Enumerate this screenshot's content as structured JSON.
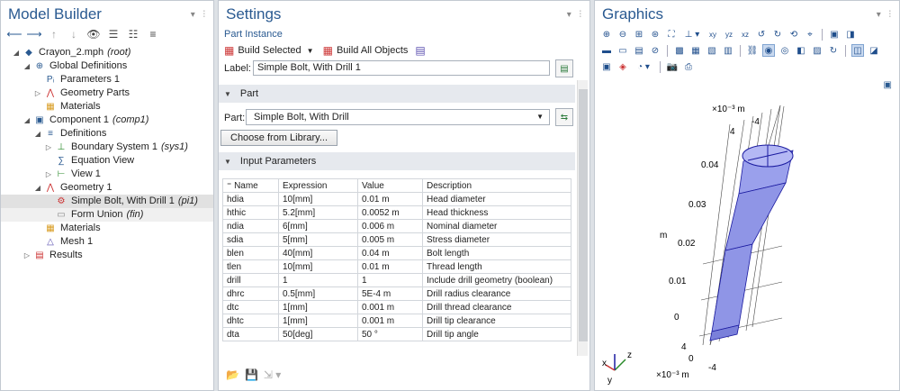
{
  "model_builder": {
    "title": "Model Builder",
    "tree": [
      {
        "label": "Crayon_2.mph",
        "suffix": "(root)",
        "level": 0,
        "tw": "◢",
        "icon": "model-icon"
      },
      {
        "label": "Global Definitions",
        "suffix": "",
        "level": 1,
        "tw": "◢",
        "icon": "globe-icon"
      },
      {
        "label": "Parameters 1",
        "suffix": "",
        "level": 2,
        "tw": "",
        "icon": "parameters-icon"
      },
      {
        "label": "Geometry Parts",
        "suffix": "",
        "level": 2,
        "tw": "▷",
        "icon": "geometry-parts-icon"
      },
      {
        "label": "Materials",
        "suffix": "",
        "level": 2,
        "tw": "",
        "icon": "materials-icon"
      },
      {
        "label": "Component 1",
        "suffix": "(comp1)",
        "level": 1,
        "tw": "◢",
        "icon": "component-icon"
      },
      {
        "label": "Definitions",
        "suffix": "",
        "level": 2,
        "tw": "◢",
        "icon": "definitions-icon"
      },
      {
        "label": "Boundary System 1",
        "suffix": "(sys1)",
        "level": 3,
        "tw": "▷",
        "icon": "boundary-system-icon"
      },
      {
        "label": "Equation View",
        "suffix": "",
        "level": 3,
        "tw": "",
        "icon": "equation-view-icon"
      },
      {
        "label": "View 1",
        "suffix": "",
        "level": 3,
        "tw": "▷",
        "icon": "view-icon"
      },
      {
        "label": "Geometry 1",
        "suffix": "",
        "level": 2,
        "tw": "◢",
        "icon": "geometry-icon"
      },
      {
        "label": "Simple Bolt, With Drill 1",
        "suffix": "(pi1)",
        "level": 3,
        "tw": "",
        "icon": "part-instance-icon",
        "selected": true
      },
      {
        "label": "Form Union",
        "suffix": "(fin)",
        "level": 3,
        "tw": "",
        "icon": "form-union-icon",
        "selected2": true
      },
      {
        "label": "Materials",
        "suffix": "",
        "level": 2,
        "tw": "",
        "icon": "materials-icon"
      },
      {
        "label": "Mesh 1",
        "suffix": "",
        "level": 2,
        "tw": "",
        "icon": "mesh-icon"
      },
      {
        "label": "Results",
        "suffix": "",
        "level": 1,
        "tw": "▷",
        "icon": "results-icon"
      }
    ]
  },
  "settings": {
    "title": "Settings",
    "subtitle": "Part Instance",
    "build_selected": "Build Selected",
    "build_all": "Build All Objects",
    "label_caption": "Label:",
    "label_value": "Simple Bolt, With Drill 1",
    "section_part": "Part",
    "part_caption": "Part:",
    "part_value": "Simple Bolt, With Drill",
    "choose_library": "Choose from Library...",
    "section_input": "Input Parameters",
    "columns": [
      "Name",
      "Expression",
      "Value",
      "Description"
    ],
    "rows": [
      [
        "hdia",
        "10[mm]",
        "0.01 m",
        "Head diameter"
      ],
      [
        "hthic",
        "5.2[mm]",
        "0.0052 m",
        "Head thickness"
      ],
      [
        "ndia",
        "6[mm]",
        "0.006 m",
        "Nominal diameter"
      ],
      [
        "sdia",
        "5[mm]",
        "0.005 m",
        "Stress diameter"
      ],
      [
        "blen",
        "40[mm]",
        "0.04 m",
        "Bolt length"
      ],
      [
        "tlen",
        "10[mm]",
        "0.01 m",
        "Thread length"
      ],
      [
        "drill",
        "1",
        "1",
        "Include drill geometry (boolean)"
      ],
      [
        "dhrc",
        "0.5[mm]",
        "5E-4 m",
        "Drill radius clearance"
      ],
      [
        "dtc",
        "1[mm]",
        "0.001 m",
        "Drill thread clearance"
      ],
      [
        "dhtc",
        "1[mm]",
        "0.001 m",
        "Drill tip clearance"
      ],
      [
        "dta",
        "50[deg]",
        "50 °",
        "Drill tip angle"
      ]
    ]
  },
  "graphics": {
    "title": "Graphics",
    "scale_top": "×10⁻³ m",
    "scale_bottom": "×10⁻³ m",
    "tick_neg4_top": "-4",
    "tick_4_top": "4",
    "axis_z": [
      "0.04",
      "0.03",
      "0.02",
      "0.01",
      "0"
    ],
    "axis_unit": "m",
    "tick_4_bottom": "4",
    "tick_0_bottom": "0",
    "tick_neg4_bottom": "-4",
    "triad": {
      "x": "x",
      "y": "y",
      "z": "z"
    }
  },
  "colors": {
    "title": "#2a5a91",
    "bolt": "#8f95e6",
    "bolt_edge": "#1a1aa0"
  }
}
